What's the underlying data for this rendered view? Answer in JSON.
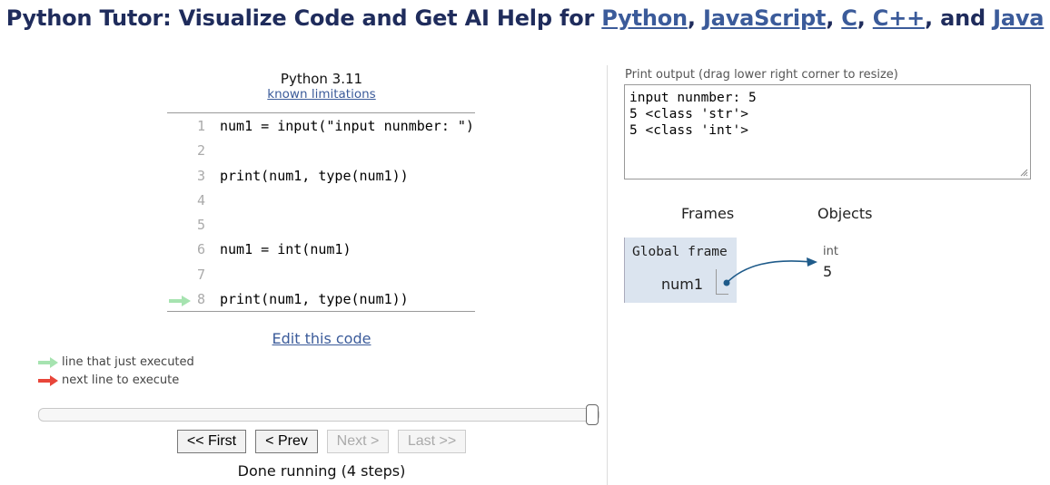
{
  "header": {
    "prefix": "Python Tutor: Visualize Code and Get AI Help for ",
    "langs": [
      "Python",
      "JavaScript",
      "C",
      "C++",
      "Java"
    ],
    "sep1": ", ",
    "sep2": ", ",
    "sep3": ", ",
    "sep4": ", and "
  },
  "editor": {
    "version": "Python 3.11",
    "limits_link": "known limitations",
    "lines": [
      {
        "num": "1",
        "text": "num1 = input(\"input nunmber: \")"
      },
      {
        "num": "2",
        "text": ""
      },
      {
        "num": "3",
        "text": "print(num1, type(num1))"
      },
      {
        "num": "4",
        "text": ""
      },
      {
        "num": "5",
        "text": ""
      },
      {
        "num": "6",
        "text": "num1 = int(num1)"
      },
      {
        "num": "7",
        "text": ""
      },
      {
        "num": "8",
        "text": "print(num1, type(num1))"
      }
    ],
    "current_line": "8",
    "edit_link": "Edit this code"
  },
  "legend": {
    "executed": "line that just executed",
    "next": "next line to execute",
    "executed_color": "#a6e3b0",
    "next_color": "#e8463a"
  },
  "navigation": {
    "progress": 1.0,
    "first": "<< First",
    "prev": "< Prev",
    "next": "Next >",
    "last": "Last >>",
    "status": "Done running (4 steps)"
  },
  "output": {
    "label": "Print output (drag lower right corner to resize)",
    "lines": [
      "input nunmber: 5",
      "5 <class 'str'>",
      "5 <class 'int'>"
    ]
  },
  "viz": {
    "frames_header": "Frames",
    "objects_header": "Objects",
    "frame_title": "Global frame",
    "var_name": "num1",
    "object_type": "int",
    "object_value": "5",
    "frame_bg": "#dbe4ef",
    "pointer_color": "#1f5b8a"
  },
  "icons": {
    "arrow": "right-arrow-icon",
    "resize": "resize-grip-icon"
  }
}
